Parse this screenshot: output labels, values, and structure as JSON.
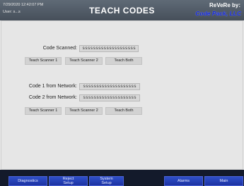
{
  "header": {
    "datetime": "7/29/2020 12:42:07 PM",
    "user": "User:  s...s",
    "title": "TEACH CODES",
    "brand_line1": "ReVeRe by:",
    "brand_line2": "Code Pack, LLC"
  },
  "scan_section": {
    "label": "Code Scanned:",
    "value": "ssssssssssssssssssss",
    "buttons": [
      "Teach Scanner 1",
      "Teach Scanner 2",
      "Teach Both"
    ]
  },
  "network_section": {
    "code1_label": "Code 1 from Network:",
    "code1_value": "ssssssssssssssssssss",
    "code2_label": "Code 2 from Network:",
    "code2_value": "ssssssssssssssssssss",
    "buttons": [
      "Teach Scanner 1",
      "Teach Scanner 2",
      "Teach Both"
    ]
  },
  "footer_nav": {
    "diagnostics": "Diagnostics",
    "reject_setup": "Reject\nSetup",
    "system_setup": "System\nSetup",
    "alarms": "Alarms",
    "main": "Main"
  }
}
